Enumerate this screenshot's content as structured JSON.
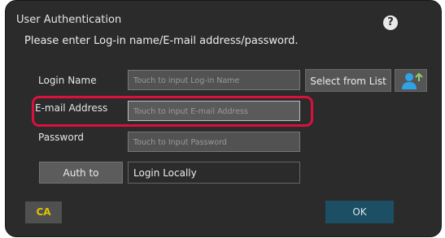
{
  "dialog": {
    "title": "User Authentication",
    "help_icon": "question-icon",
    "instruction": "Please enter Log-in name/E-mail address/password."
  },
  "form": {
    "login_name": {
      "label": "Login Name",
      "placeholder": "Touch to input Log-in Name"
    },
    "email": {
      "label": "E-mail Address",
      "placeholder": "Touch to input E-mail Address"
    },
    "password": {
      "label": "Password",
      "placeholder": "Touch to Input Password"
    },
    "select_from_list_label": "Select from List",
    "user_icon": "add-user-icon",
    "auth_to_label": "Auth to",
    "auth_to_value": "Login Locally"
  },
  "footer": {
    "ca_label": "CA",
    "ok_label": "OK"
  },
  "colors": {
    "panel": "#2b2b2b",
    "highlight": "#d9113c",
    "ok_button": "#1c4f63",
    "ca_text": "#e0c400",
    "user_icon": "#2fa3e6"
  }
}
